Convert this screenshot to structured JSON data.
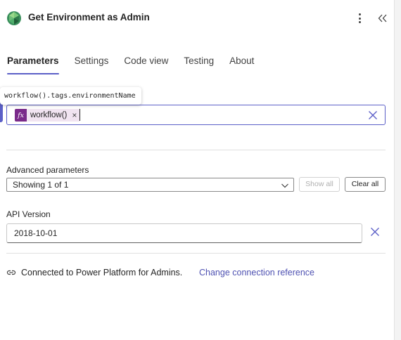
{
  "header": {
    "title": "Get Environment as Admin",
    "logo_icon": "power-platform-logo",
    "more_icon": "more-vertical-icon",
    "collapse_icon": "double-chevron-left-icon"
  },
  "tabs": [
    {
      "label": "Parameters",
      "active": true
    },
    {
      "label": "Settings",
      "active": false
    },
    {
      "label": "Code view",
      "active": false
    },
    {
      "label": "Testing",
      "active": false
    },
    {
      "label": "About",
      "active": false
    }
  ],
  "expression_field": {
    "tooltip": "workflow().tags.environmentName",
    "token_icon_text": "fx",
    "token_label": "workflow()",
    "token_remove": "×"
  },
  "advanced": {
    "label": "Advanced parameters",
    "selected": "Showing 1 of 1",
    "show_all": "Show all",
    "clear_all": "Clear all"
  },
  "api_version": {
    "label": "API Version",
    "value": "2018-10-01"
  },
  "connection": {
    "text": "Connected to Power Platform for Admins.",
    "link": "Change connection reference"
  },
  "colors": {
    "accent": "#5b5fc7",
    "link": "#4f52b2",
    "token_bg": "#f1e4f1",
    "token_icon_bg": "#7a2a8a"
  }
}
